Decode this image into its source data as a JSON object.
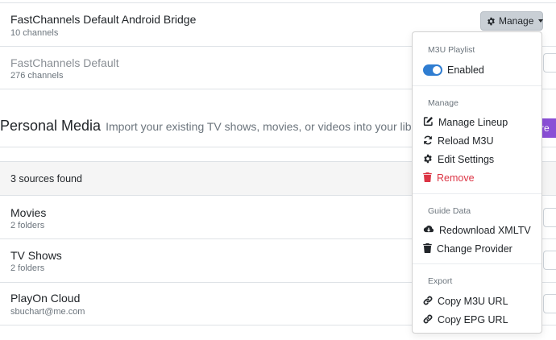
{
  "sources_top": [
    {
      "name": "FastChannels Default Android Bridge",
      "sub": "10 channels"
    },
    {
      "name": "FastChannels Default",
      "sub": "276 channels"
    }
  ],
  "manage_button": {
    "label": "Manage",
    "icon": "gear-icon"
  },
  "personal_media": {
    "title": "Personal Media",
    "description": "Import your existing TV shows, movies, or videos into your libra",
    "button_label": "re"
  },
  "sources_found": "3 sources found",
  "media_sources": [
    {
      "name": "Movies",
      "sub": "2 folders"
    },
    {
      "name": "TV Shows",
      "sub": "2 folders"
    },
    {
      "name": "PlayOn Cloud",
      "sub": "sbuchart@me.com"
    }
  ],
  "dropdown": {
    "m3u_header": "M3U Playlist",
    "enabled_label": "Enabled",
    "enabled": true,
    "manage_header": "Manage",
    "manage_items": [
      {
        "label": "Manage Lineup",
        "icon": "edit-icon"
      },
      {
        "label": "Reload M3U",
        "icon": "sync-icon"
      },
      {
        "label": "Edit Settings",
        "icon": "gear-icon"
      },
      {
        "label": "Remove",
        "icon": "trash-icon",
        "danger": true
      }
    ],
    "guide_header": "Guide Data",
    "guide_items": [
      {
        "label": "Redownload XMLTV",
        "icon": "cloud-download-icon"
      },
      {
        "label": "Change Provider",
        "icon": "trash-icon"
      }
    ],
    "export_header": "Export",
    "export_items": [
      {
        "label": "Copy M3U URL",
        "icon": "link-icon"
      },
      {
        "label": "Copy EPG URL",
        "icon": "link-icon"
      }
    ]
  },
  "colors": {
    "accent": "#2f7dd1",
    "danger": "#dc3545",
    "purple": "#8a4fd6",
    "manage_bg": "#c9cfd5"
  }
}
